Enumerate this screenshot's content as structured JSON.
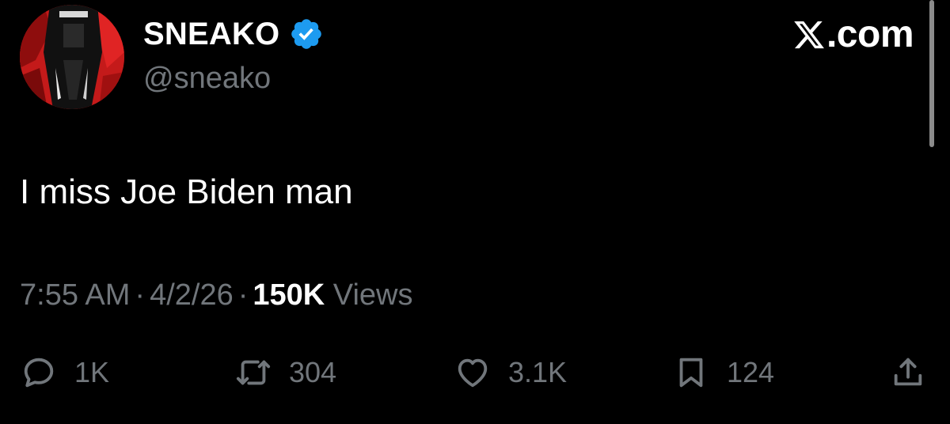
{
  "author": {
    "display_name": "SNEAKO",
    "handle": "@sneako",
    "verified": true,
    "avatar": "avatar-image"
  },
  "brand": {
    "logo": "x-logo-icon",
    "domain_suffix": ".com"
  },
  "tweet": {
    "text": "I miss Joe Biden man"
  },
  "meta": {
    "time": "7:55 AM",
    "separator": "·",
    "date": "4/2/26",
    "views_count": "150K",
    "views_label": "Views"
  },
  "actions": {
    "reply": {
      "icon": "reply-icon",
      "count": "1K"
    },
    "repost": {
      "icon": "repost-icon",
      "count": "304"
    },
    "like": {
      "icon": "heart-icon",
      "count": "3.1K"
    },
    "bookmark": {
      "icon": "bookmark-icon",
      "count": "124"
    },
    "share": {
      "icon": "share-icon"
    }
  },
  "colors": {
    "background": "#000000",
    "primary_text": "#ffffff",
    "secondary_text": "#71767b",
    "verified_badge": "#1d9bf0",
    "avatar_accent": "#c41a1a"
  }
}
